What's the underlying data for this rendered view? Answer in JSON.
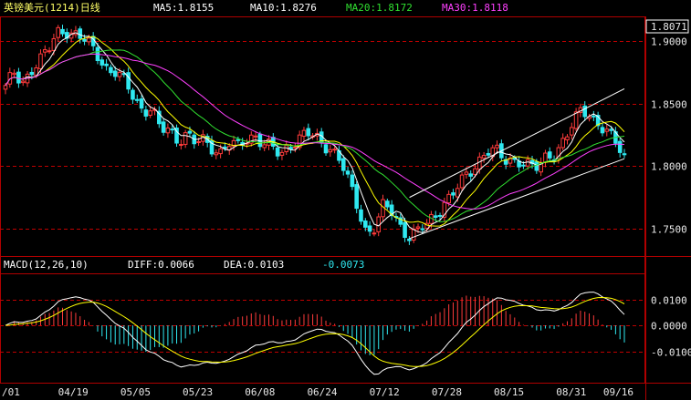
{
  "title": "英镑美元(1214)日线",
  "colors": {
    "bg": "#000000",
    "frame": "#b00000",
    "grid": "#c00000",
    "up": "#ff3b3b",
    "down": "#2fe8f0",
    "ma5": "#ffffff",
    "ma10": "#ffff00",
    "ma20": "#30e030",
    "ma30": "#ff40ff",
    "diff": "#ffffff",
    "dea": "#ffff00",
    "trend": "#ffffff"
  },
  "ma_legend": [
    {
      "label": "MA5:1.8155",
      "color": "#ffffff"
    },
    {
      "label": "MA10:1.8276",
      "color": "#ffffff"
    },
    {
      "label": "MA20:1.8172",
      "color": "#30e030"
    },
    {
      "label": "MA30:1.8118",
      "color": "#ff40ff"
    }
  ],
  "macd_legend": [
    {
      "label": "MACD(12,26,10)",
      "color": "#ffffff"
    },
    {
      "label": "DIFF:0.0066",
      "color": "#ffffff"
    },
    {
      "label": "DEA:0.0103",
      "color": "#ffffff"
    },
    {
      "label": "-0.0073",
      "color": "#2fe8f0"
    }
  ],
  "current_price": "1.8071",
  "chart_data": [
    {
      "type": "candlestick",
      "x_labels": [
        "/01",
        "04/19",
        "05/05",
        "05/23",
        "06/08",
        "06/24",
        "07/12",
        "07/28",
        "08/15",
        "08/31",
        "09/16"
      ],
      "y_ticks": [
        "1.9000",
        "1.8500",
        "1.8000",
        "1.7500"
      ],
      "ylim": [
        1.728,
        1.92
      ],
      "ma_periods": [
        5,
        10,
        20,
        30
      ],
      "close_path": [
        1.862,
        1.874,
        1.868,
        1.878,
        1.884,
        1.892,
        1.908,
        1.91,
        1.905,
        1.901,
        1.896,
        1.888,
        1.876,
        1.874,
        1.865,
        1.856,
        1.845,
        1.846,
        1.828,
        1.83,
        1.822,
        1.826,
        1.818,
        1.82,
        1.816,
        1.812,
        1.818,
        1.814,
        1.822,
        1.826,
        1.818,
        1.814,
        1.808,
        1.818,
        1.822,
        1.826,
        1.822,
        1.818,
        1.815,
        1.804,
        1.785,
        1.766,
        1.748,
        1.752,
        1.768,
        1.762,
        1.752,
        1.745,
        1.748,
        1.752,
        1.76,
        1.772,
        1.778,
        1.786,
        1.794,
        1.805,
        1.814,
        1.812,
        1.803,
        1.805,
        1.806,
        1.8,
        1.797,
        1.808,
        1.812,
        1.822,
        1.832,
        1.845,
        1.842,
        1.835,
        1.826,
        1.818,
        1.807
      ],
      "trend_lines": [
        {
          "from": [
            47,
            1.742
          ],
          "to": [
            72,
            1.806
          ]
        },
        {
          "from": [
            47,
            1.775
          ],
          "to": [
            72,
            1.862
          ]
        }
      ]
    },
    {
      "type": "macd",
      "params": "12,26,10",
      "y_ticks": [
        "0.0100",
        "0.0000",
        "-0.0100"
      ],
      "ylim": [
        -0.022,
        0.02
      ],
      "last": {
        "diff": 0.0066,
        "dea": 0.0103,
        "macd": -0.0073
      }
    }
  ]
}
